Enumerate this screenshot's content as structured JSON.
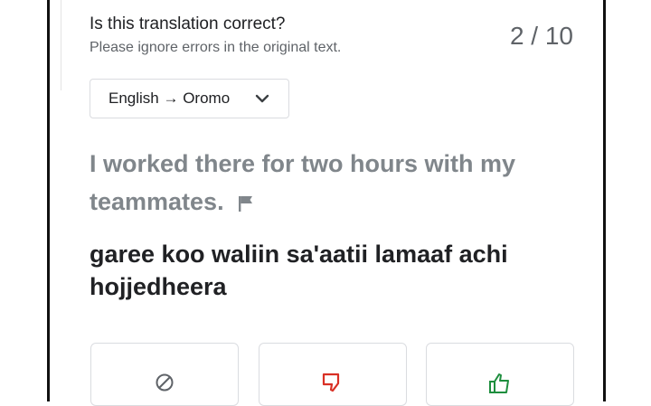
{
  "header": {
    "title": "Is this translation correct?",
    "subtitle": "Please ignore errors in the original text.",
    "progress": "2 / 10"
  },
  "language_select": {
    "value": "English → Oromo",
    "icon": "chevron-down-icon"
  },
  "source": {
    "text": "I worked there for two hours with my teammates.",
    "flag_icon": "flag-icon"
  },
  "translation": {
    "text": "garee koo waliin sa'aatii lamaaf achi hojjedheera"
  },
  "choices": [
    {
      "icon": "skip-icon",
      "color": "#5f6368"
    },
    {
      "icon": "thumbs-down-icon",
      "color": "#d93025"
    },
    {
      "icon": "thumbs-up-icon",
      "color": "#1e8e3e"
    }
  ],
  "colors": {
    "text_primary": "#202124",
    "text_secondary": "#5f6368",
    "source_text": "#80868b",
    "border": "#dadce0"
  }
}
